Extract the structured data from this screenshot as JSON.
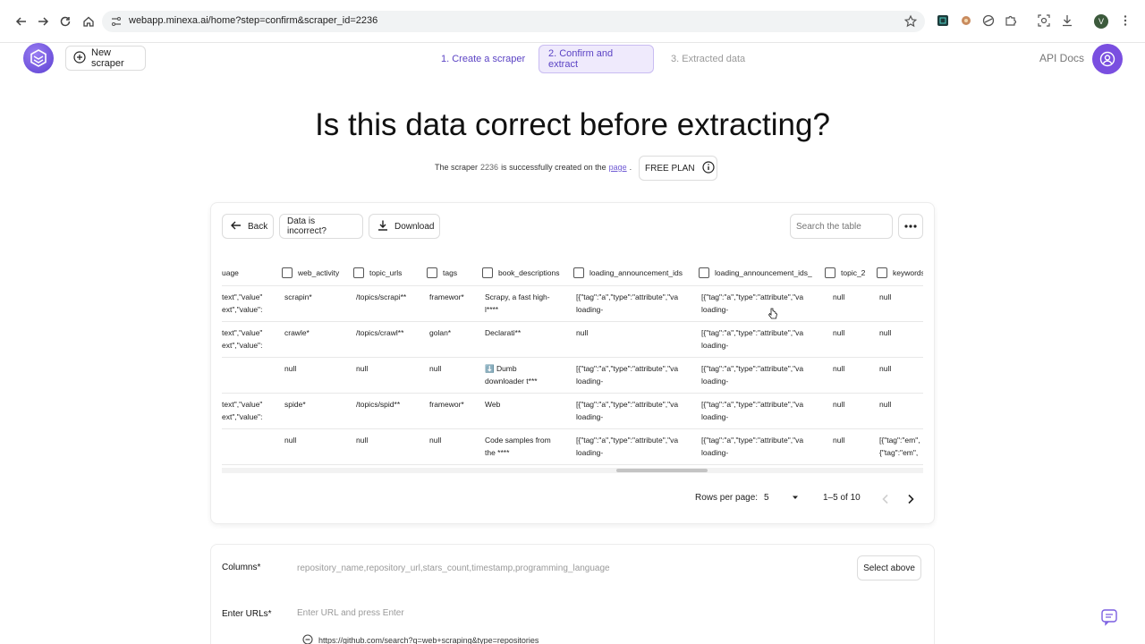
{
  "browser": {
    "url": "webapp.minexa.ai/home?step=confirm&scraper_id=2236",
    "profile_initial": "V"
  },
  "header": {
    "new_scraper_label": "New scraper",
    "steps": [
      "1. Create a scraper",
      "2. Confirm and extract",
      "3. Extracted data"
    ],
    "active_step": 1,
    "api_docs_label": "API Docs",
    "brand_color": "#6b4de0"
  },
  "main": {
    "title": "Is this data correct before extracting?",
    "sub_prefix": "The scraper",
    "scraper_id": "2236",
    "sub_middle": "is successfully created on the",
    "sub_link": "page",
    "sub_end": ".",
    "plan_label": "FREE PLAN"
  },
  "toolbar": {
    "back_label": "Back",
    "incorrect_label": "Data is incorrect?",
    "download_label": "Download",
    "search_placeholder": "Search the table"
  },
  "table": {
    "columns": [
      "uage",
      "web_activity",
      "topic_urls",
      "tags",
      "book_descriptions",
      "loading_announcement_ids",
      "loading_announcement_ids_",
      "topic_2",
      "keywords"
    ],
    "rows": [
      [
        "text\",\"value\"\next\",\"value\":",
        "scrapin*",
        "/topics/scrapi**",
        "framewor*",
        "Scrapy, a fast high-\nl****",
        "[{\"tag\":\"a\",\"type\":\"attribute\",\"va\nloading-",
        "[{\"tag\":\"a\",\"type\":\"attribute\",\"va\nloading-",
        "null",
        "null"
      ],
      [
        "text\",\"value\"\next\",\"value\":",
        "crawle*",
        "/topics/crawl**",
        "golan*",
        "Declarati**",
        "null",
        "[{\"tag\":\"a\",\"type\":\"attribute\",\"va\nloading-",
        "null",
        "null"
      ],
      [
        "",
        "null",
        "null",
        "null",
        "⬇️ Dumb\ndownloader t***",
        "[{\"tag\":\"a\",\"type\":\"attribute\",\"va\nloading-",
        "[{\"tag\":\"a\",\"type\":\"attribute\",\"va\nloading-",
        "null",
        "null"
      ],
      [
        "text\",\"value\"\next\",\"value\":",
        "spide*",
        "/topics/spid**",
        "framewor*",
        "Web",
        "[{\"tag\":\"a\",\"type\":\"attribute\",\"va\nloading-",
        "[{\"tag\":\"a\",\"type\":\"attribute\",\"va\nloading-",
        "null",
        "null"
      ],
      [
        "",
        "null",
        "null",
        "null",
        "Code samples from\nthe ****",
        "[{\"tag\":\"a\",\"type\":\"attribute\",\"va\nloading-",
        "[{\"tag\":\"a\",\"type\":\"attribute\",\"va\nloading-",
        "null",
        "[{\"tag\":\"em\",\n{\"tag\":\"em\","
      ]
    ]
  },
  "pagination": {
    "rows_per_page_label": "Rows per page:",
    "rows_per_page_value": "5",
    "range_label": "1–5 of 10"
  },
  "form": {
    "columns_label": "Columns*",
    "columns_placeholder": "repository_name,repository_url,stars_count,timestamp,programming_language",
    "select_above_label": "Select above",
    "urls_label": "Enter URLs*",
    "urls_placeholder": "Enter URL and press Enter",
    "url_item": "https://github.com/search?q=web+scraping&type=repositories"
  }
}
